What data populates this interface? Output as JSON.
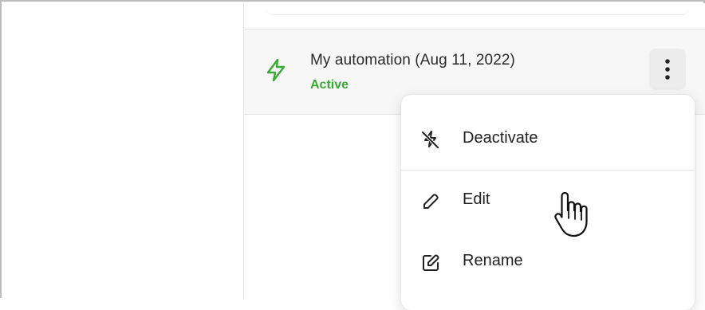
{
  "automation": {
    "title": "My automation (Aug 11, 2022)",
    "status": "Active",
    "status_color": "#3aa935",
    "icon": "lightning-bolt-icon"
  },
  "row_menu": {
    "icon": "more-vertical-icon"
  },
  "context_menu": {
    "items": [
      {
        "label": "Deactivate",
        "icon": "lightning-off-icon"
      },
      {
        "label": "Edit",
        "icon": "pencil-icon"
      },
      {
        "label": "Rename",
        "icon": "rename-icon"
      }
    ]
  },
  "cursor": {
    "icon": "hand-pointer-icon"
  }
}
